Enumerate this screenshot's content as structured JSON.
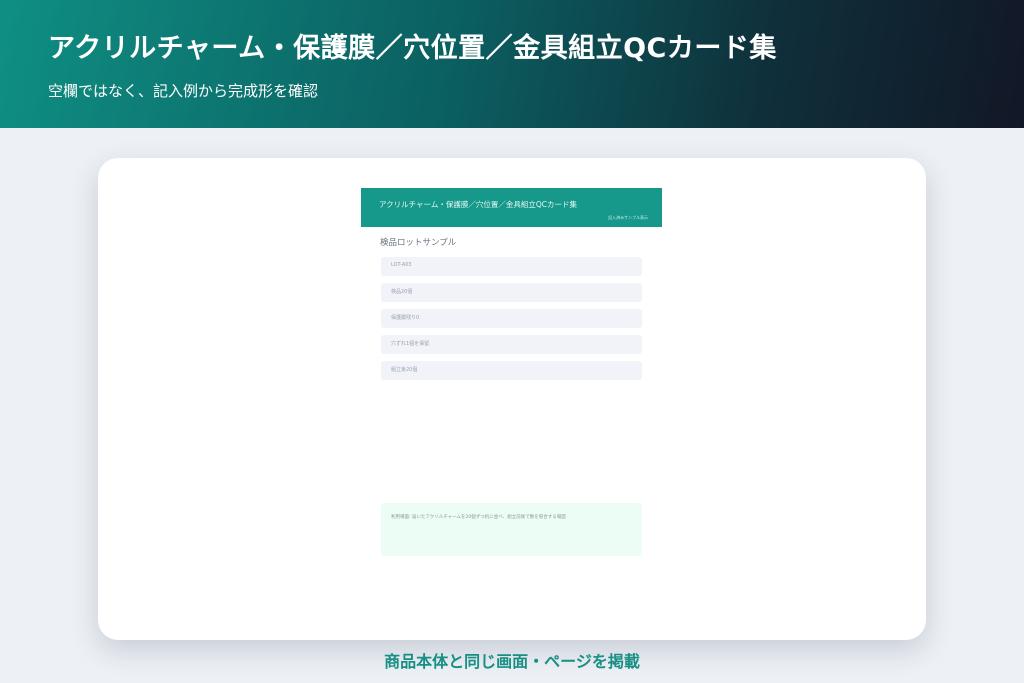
{
  "hero": {
    "title": "アクリルチャーム・保護膜／穴位置／金具組立QCカード集",
    "subtitle": "空欄ではなく、記入例から完成形を確認"
  },
  "preview": {
    "header_title": "アクリルチャーム・保護膜／穴位置／金具組立QCカード集",
    "header_tag": "記入済みサンプル表示",
    "section_title": "検品ロットサンプル",
    "fields": [
      "LOT-A03",
      "検品20個",
      "保護膜残り0",
      "穴ずれ1個を保留",
      "組立後20個"
    ],
    "note": "利用場面: 届いたアクリルチャームを20個ずつ机に並べ、組立前後で数を照合する場面"
  },
  "caption": "商品本体と同じ画面・ページを掲載",
  "colors": {
    "accent": "#16988a",
    "caption": "#178f84",
    "background": "#edf1f6",
    "field": "#f1f3f8",
    "note": "#ecfdf5"
  }
}
